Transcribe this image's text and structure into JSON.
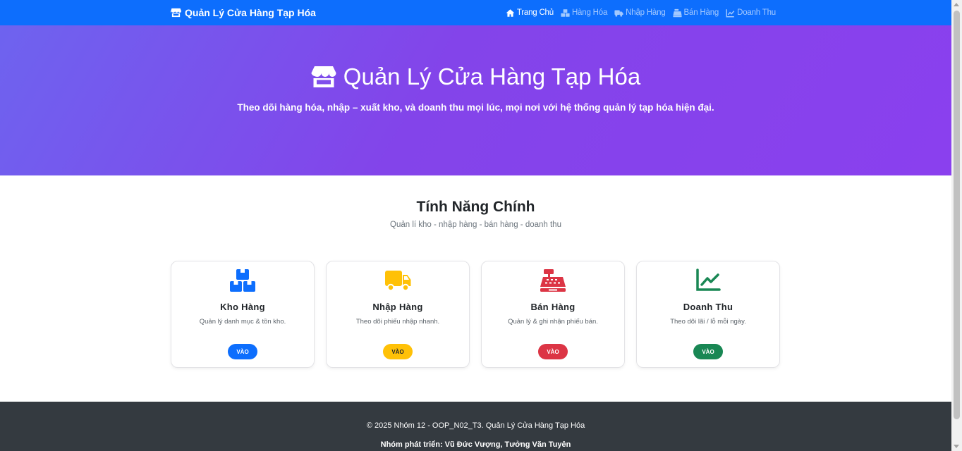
{
  "navbar": {
    "brand": "Quản Lý Cửa Hàng Tạp Hóa",
    "brand_icon": "store-icon",
    "links": [
      {
        "label": "Trang Chủ",
        "icon": "home-icon",
        "active": true
      },
      {
        "label": "Hàng Hóa",
        "icon": "boxes-icon",
        "active": false
      },
      {
        "label": "Nhập Hàng",
        "icon": "truck-icon",
        "active": false
      },
      {
        "label": "Bán Hàng",
        "icon": "cash-register-icon",
        "active": false
      },
      {
        "label": "Doanh Thu",
        "icon": "chart-line-icon",
        "active": false
      }
    ]
  },
  "hero": {
    "title": "Quản Lý Cửa Hàng Tạp Hóa",
    "subtitle": "Theo dõi hàng hóa, nhập – xuất kho, và doanh thu mọi lúc, mọi nơi với hệ thống quản lý tạp hóa hiện đại."
  },
  "features": {
    "title": "Tính Năng Chính",
    "subtitle": "Quản lí kho - nhập hàng - bán hàng - doanh thu",
    "cards": [
      {
        "title": "Kho Hàng",
        "desc": "Quản lý danh mục & tồn kho.",
        "button": "VÀO",
        "color": "#0d6efd",
        "icon": "boxes-icon"
      },
      {
        "title": "Nhập Hàng",
        "desc": "Theo dõi phiếu nhập nhanh.",
        "button": "VÀO",
        "color": "#ffc107",
        "icon": "truck-icon"
      },
      {
        "title": "Bán Hàng",
        "desc": "Quản lý & ghi nhận phiếu bán.",
        "button": "VÀO",
        "color": "#dc3545",
        "icon": "cash-register-icon"
      },
      {
        "title": "Doanh Thu",
        "desc": "Theo dõi lãi / lỗ mỗi ngày.",
        "button": "VÀO",
        "color": "#198754",
        "icon": "chart-line-icon"
      }
    ]
  },
  "footer": {
    "copyright": "© 2025 Nhóm 12 - OOP_N02_T3. Quản Lý Cửa Hàng Tạp Hóa",
    "team": "Nhóm phát triển: Vũ Đức Vượng, Tưởng Văn Tuyên"
  },
  "colors": {
    "primary": "#0d6efd",
    "hero_gradient_start": "#6e63ef",
    "hero_gradient_end": "#8a40ee",
    "footer_bg": "#343a40"
  }
}
